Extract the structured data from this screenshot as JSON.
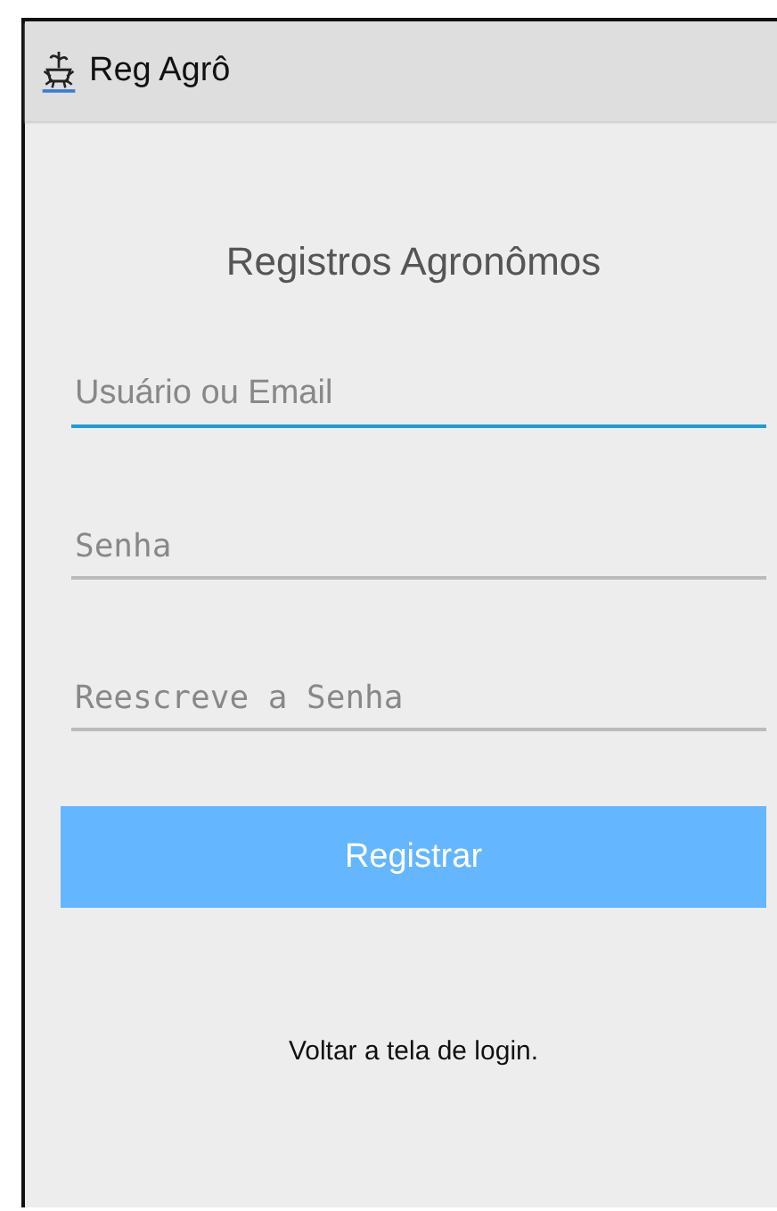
{
  "app_bar": {
    "title": "Reg Agrô"
  },
  "heading": "Registros Agronômos",
  "fields": [
    {
      "placeholder": "Usuário ou Email",
      "kind": "text",
      "focused": true
    },
    {
      "placeholder": "Senha",
      "kind": "password",
      "focused": false
    },
    {
      "placeholder": "Reescreve a Senha",
      "kind": "password",
      "focused": false
    }
  ],
  "register_button": "Registrar",
  "back_link": "Voltar a tela de login."
}
